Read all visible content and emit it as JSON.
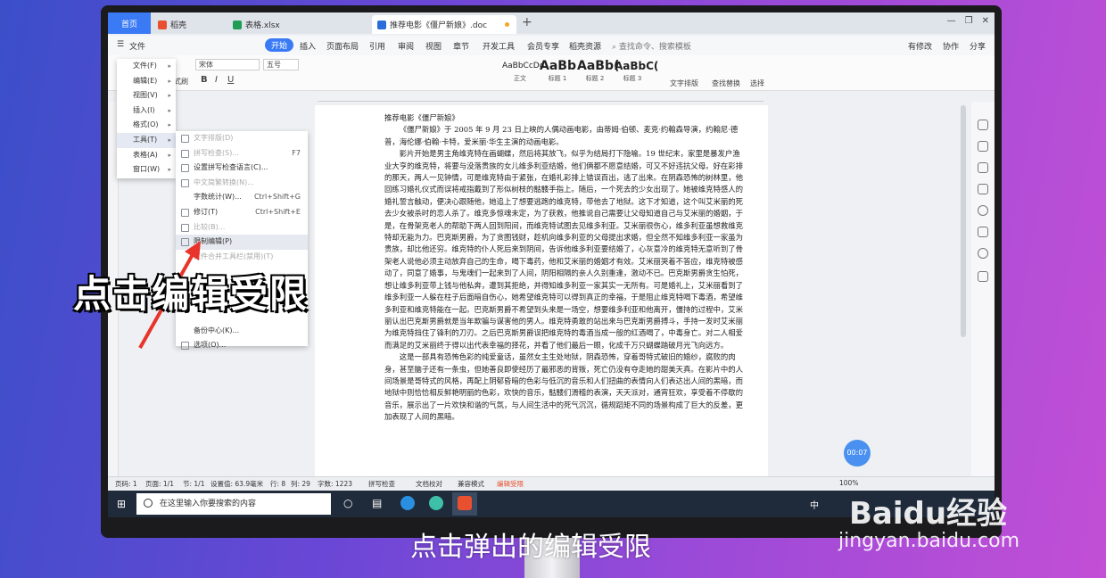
{
  "tabs": {
    "home": "首页",
    "t1": "稻壳",
    "t2": "表格.xlsx",
    "t3": "推荐电影《僵尸新娘》.doc"
  },
  "menubar": {
    "file": "文件",
    "start": "开始",
    "items": [
      "插入",
      "页面布局",
      "引用",
      "审阅",
      "视图",
      "章节",
      "开发工具",
      "会员专享",
      "稻壳资源"
    ],
    "search": "查找命令、搜索模板",
    "has_changes": "有修改",
    "collab": "协作",
    "share": "分享"
  },
  "ribbon": {
    "font": "宋体",
    "size": "五号",
    "format_painter": "式刷",
    "styles": [
      {
        "preview": "AaBbCcDd",
        "name": "正文"
      },
      {
        "preview": "AaBb",
        "name": "标题 1"
      },
      {
        "preview": "AaBb(",
        "name": "标题 2"
      },
      {
        "preview": "AaBbC(",
        "name": "标题 3"
      }
    ],
    "text_layout": "文字排版",
    "find_replace": "查找替换",
    "select": "选择"
  },
  "left_menu": [
    "文件(F)",
    "编辑(E)",
    "视图(V)",
    "插入(I)",
    "格式(O)",
    "工具(T)",
    "表格(A)",
    "窗口(W)"
  ],
  "sub_menu": [
    {
      "label": "文字排版(D)",
      "shortcut": "",
      "disabled": true
    },
    {
      "label": "拼写检查(S)...",
      "shortcut": "F7",
      "disabled": true
    },
    {
      "label": "设置拼写检查语言(C)...",
      "shortcut": "",
      "disabled": false
    },
    {
      "label": "中文简繁转换(N)...",
      "shortcut": "",
      "disabled": true
    },
    {
      "label": "字数统计(W)...",
      "shortcut": "Ctrl+Shift+G",
      "disabled": false
    },
    {
      "label": "修订(T)",
      "shortcut": "Ctrl+Shift+E",
      "disabled": false
    },
    {
      "label": "比较(B)...",
      "shortcut": "",
      "disabled": true
    },
    {
      "label": "限制编辑(P)",
      "shortcut": "",
      "disabled": false,
      "highlight": true
    },
    {
      "label": "文件合并工具栏(禁用)(T)",
      "shortcut": "",
      "disabled": true
    },
    {
      "label": "",
      "shortcut": "",
      "disabled": false
    },
    {
      "label": "",
      "shortcut": "",
      "disabled": false
    },
    {
      "label": "",
      "shortcut": "",
      "disabled": false
    },
    {
      "label": "",
      "shortcut": "",
      "disabled": false
    },
    {
      "label": "备份中心(K)...",
      "shortcut": "",
      "disabled": false
    },
    {
      "label": "选项(O)...",
      "shortcut": "",
      "disabled": false
    }
  ],
  "document": {
    "title": "推荐电影《僵尸新娘》",
    "p1": "《僵尸新娘》于 2005 年 9 月 23 日上映的人偶动画电影，由蒂姆·伯顿、麦克·约翰森导演，约翰尼·德普，海伦娜·伯翰·卡特，爱米丽·华生主演的动画电影。",
    "p2": "影片开始是男主角维克特在画蝴蝶，然后将其放飞，似乎为结局打下隐喻。19 世纪末，家里是暴发户渔业大亨的维克特，将要与没落贵族的女儿维多利亚结婚，他们俩都不愿意结婚，可又不好违抗父母。好在彩排的那天，两人一见钟情，可是维克特由于紧张，在婚礼彩排上错误百出，逃了出来。在阴森恐怖的树林里，他回练习婚礼仪式而误将戒指戴到了形似树枝的骷髅手指上。随后，一个死去的少女出现了。她被维克特感人的婚礼誓言触动，便决心跟随他，她追上了想要逃跑的维克特，带他去了地狱。这下才知道，这个叫艾米丽的死去少女被杀时的恋人杀了。维克多惊魂未定，为了获救，他推说自己需要让父母知道自己与艾米丽的婚姻，于是，在骨架克老人的帮助下两人回到阳间，而维克特试图去见维多利亚。艾米丽很伤心，维多利亚虽想救维克特却无能为力。巴克斯男爵，为了贪图钱财，趁机向维多利亚的父母提出求婚，但全然不知维多利亚一家虽为贵族，却比他还穷。维克特的仆人死后来到阴间，告诉他维多利亚要结婚了，心灰意冷的维克特无意听到了骨架老人说他必须主动放弃自己的生命，喝下毒药，他和艾米丽的婚姻才有效。艾米丽哭着不答应，维克特被感动了，同意了婚事，与鬼魂们一起来到了人间，阴阳相隔的亲人久别重逢，激动不已。巴克斯男爵贪生怕死，想让维多利亚带上钱与他私奔，遭到其拒绝，并得知维多利亚一家其实一无所有。可是婚礼上，艾米丽看到了维多利亚一人躲在柱子后面暗自伤心，她希望维克特可以得到真正的幸福，于是阻止维克特喝下毒酒，希望维多利亚和维克特能在一起。巴克斯男爵不希望到头来是一场空，想要维多利亚和他离开，僵持的过程中，艾米丽认出巴克斯男爵就是当年欺骗与谋害他的男人。维克特勇敢的站出来与巴克斯男爵搏斗，手持一发时艾米丽为维克特挡住了锋利的刀刃。之后巴克斯男爵误把维克特的毒酒当成一般的红酒喝了，中毒身亡。对二人相爱而满足的艾米丽终于得以出代表幸福的择花，并看了他们最后一眼，化成千万只蝴蝶踏破月光飞向远方。",
    "p3": "这是一部具有恐怖色彩的纯爱童话，虽然女主生处地狱，阴森恐怖，穿着哥特式破旧的婚纱，腐败的肉身，甚至脑子还有一条虫，但她善良即使经历了最邪恶的背叛，死亡仍没有夺走她的甜美天真。在影片中的人间场景是哥特式的风格，再配上阴郁昏暗的色彩与低沉的音乐和人们扭曲的表情向人们表达出人间的黑暗，而地狱中则恰恰相反鲜艳明丽的色彩，欢快的音乐，骷髅们滑稽的表演，天天派对，通宵狂欢，享受着不停歇的音乐，展示出了一片欢快和谐的气氛，与人间生活中的死气沉沉，循规蹈矩不同的场景构成了巨大的反差，更加表现了人间的黑暗。"
  },
  "status": {
    "items": [
      "页码: 1",
      "页面: 1/1",
      "节: 1/1",
      "设置值: 63.9毫米",
      "行: 8",
      "列: 29",
      "字数: 1223",
      "拼写检查",
      "文档校对",
      "兼容模式",
      "编辑受限"
    ],
    "zoom": "100%"
  },
  "taskbar": {
    "search": "在这里输入你要搜索的内容",
    "ime": "中"
  },
  "timer": "00:07",
  "overlay": {
    "callout": "点击编辑受限",
    "caption": "点击弹出的编辑受限",
    "watermark": "Baidu经验",
    "watermark_url": "jingyan.baidu.com"
  },
  "colors": {
    "accent": "#3a7bf5",
    "restricted": "#e8502f"
  }
}
